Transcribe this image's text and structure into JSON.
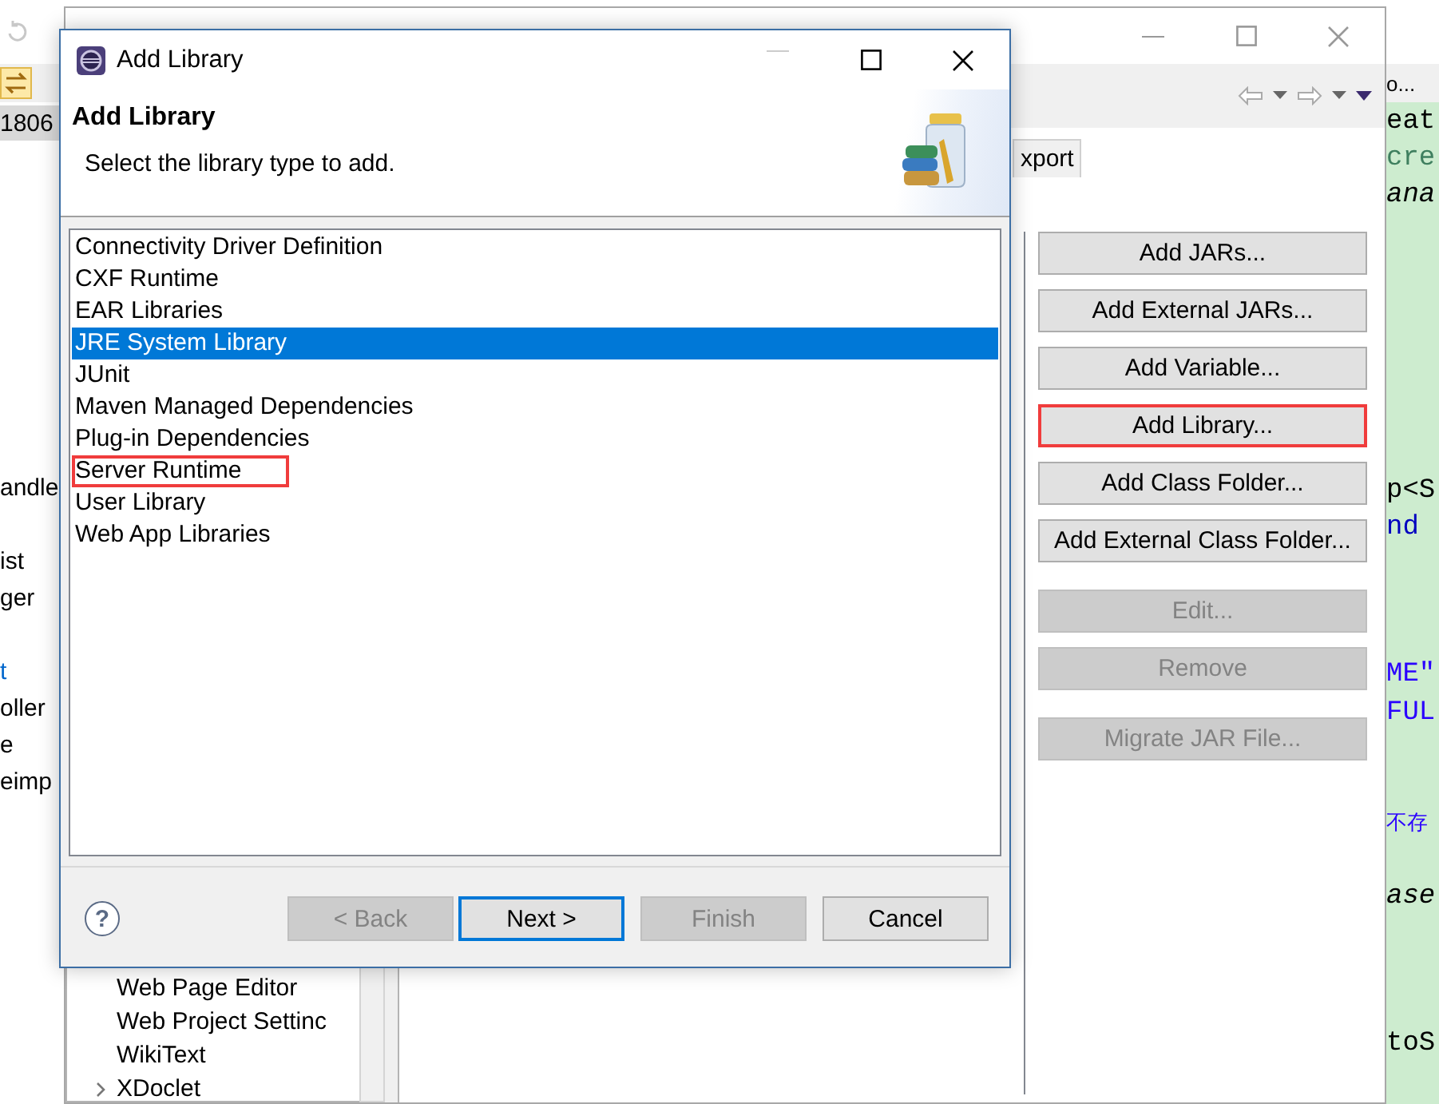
{
  "ide": {
    "project_row": {
      "label": "1806",
      "selected": true
    },
    "explorer_items": [
      {
        "kind": "plain",
        "text": "andle"
      },
      {
        "kind": "blank"
      },
      {
        "kind": "plain",
        "text": "ist"
      },
      {
        "kind": "plain",
        "text": "ger"
      },
      {
        "kind": "blank"
      },
      {
        "kind": "link",
        "text": "t"
      },
      {
        "kind": "plain",
        "text": "oller"
      },
      {
        "kind": "plain",
        "text": "e"
      },
      {
        "kind": "plain",
        "text": "eimp"
      }
    ],
    "view_label": "o...",
    "editor_lines": [
      {
        "kind": "plain",
        "text": "eat"
      },
      {
        "kind": "comment",
        "text": "cre"
      },
      {
        "kind": "italic",
        "text": "ana"
      },
      {
        "kind": "blank"
      },
      {
        "kind": "blank"
      },
      {
        "kind": "blank"
      },
      {
        "kind": "blank"
      },
      {
        "kind": "blank"
      },
      {
        "kind": "blank"
      },
      {
        "kind": "blank"
      },
      {
        "kind": "plain",
        "text": "p<S"
      },
      {
        "kind": "field",
        "text": "nd"
      },
      {
        "kind": "blank"
      },
      {
        "kind": "blank"
      },
      {
        "kind": "blank"
      },
      {
        "kind": "string",
        "text": "ME\""
      },
      {
        "kind": "string",
        "text": "FUL"
      },
      {
        "kind": "blank"
      },
      {
        "kind": "blank"
      },
      {
        "kind": "string",
        "text": "不存"
      },
      {
        "kind": "blank"
      },
      {
        "kind": "italic",
        "text": "ase"
      },
      {
        "kind": "blank"
      },
      {
        "kind": "blank"
      },
      {
        "kind": "blank"
      },
      {
        "kind": "plain",
        "text": "toS"
      }
    ]
  },
  "properties_window": {
    "tabs": [
      {
        "label": "xport",
        "selected": false
      }
    ],
    "buttons": [
      {
        "label": "Add JARs...",
        "disabled": false,
        "highlighted": false
      },
      {
        "label": "Add External JARs...",
        "disabled": false,
        "highlighted": false
      },
      {
        "label": "Add Variable...",
        "disabled": false,
        "highlighted": false
      },
      {
        "label": "Add Library...",
        "disabled": false,
        "highlighted": true
      },
      {
        "label": "Add Class Folder...",
        "disabled": false,
        "highlighted": false
      },
      {
        "label": "Add External Class Folder...",
        "disabled": false,
        "highlighted": false
      },
      {
        "label": "Edit...",
        "disabled": true,
        "highlighted": false
      },
      {
        "label": "Remove",
        "disabled": true,
        "highlighted": false
      },
      {
        "label": "Migrate JAR File...",
        "disabled": true,
        "highlighted": false
      }
    ],
    "tree_items": [
      {
        "label": "Web Page Editor",
        "expandable": false
      },
      {
        "label": "Web Project Settinc",
        "expandable": false
      },
      {
        "label": "WikiText",
        "expandable": false
      },
      {
        "label": "XDoclet",
        "expandable": true
      }
    ]
  },
  "dialog": {
    "title": "Add Library",
    "heading": "Add Library",
    "description": "Select the library type to add.",
    "library_types": [
      {
        "label": "Connectivity Driver Definition",
        "selected": false,
        "highlighted": false
      },
      {
        "label": "CXF Runtime",
        "selected": false,
        "highlighted": false
      },
      {
        "label": "EAR Libraries",
        "selected": false,
        "highlighted": false
      },
      {
        "label": "JRE System Library",
        "selected": true,
        "highlighted": false
      },
      {
        "label": "JUnit",
        "selected": false,
        "highlighted": false
      },
      {
        "label": "Maven Managed Dependencies",
        "selected": false,
        "highlighted": false
      },
      {
        "label": "Plug-in Dependencies",
        "selected": false,
        "highlighted": false
      },
      {
        "label": "Server Runtime",
        "selected": false,
        "highlighted": true
      },
      {
        "label": "User Library",
        "selected": false,
        "highlighted": false
      },
      {
        "label": "Web App Libraries",
        "selected": false,
        "highlighted": false
      }
    ],
    "help": "?",
    "buttons": [
      {
        "label": "< Back",
        "disabled": true,
        "default": false
      },
      {
        "label": "Next >",
        "disabled": false,
        "default": true
      },
      {
        "label": "Finish",
        "disabled": true,
        "default": false
      },
      {
        "label": "Cancel",
        "disabled": false,
        "default": false
      }
    ]
  }
}
